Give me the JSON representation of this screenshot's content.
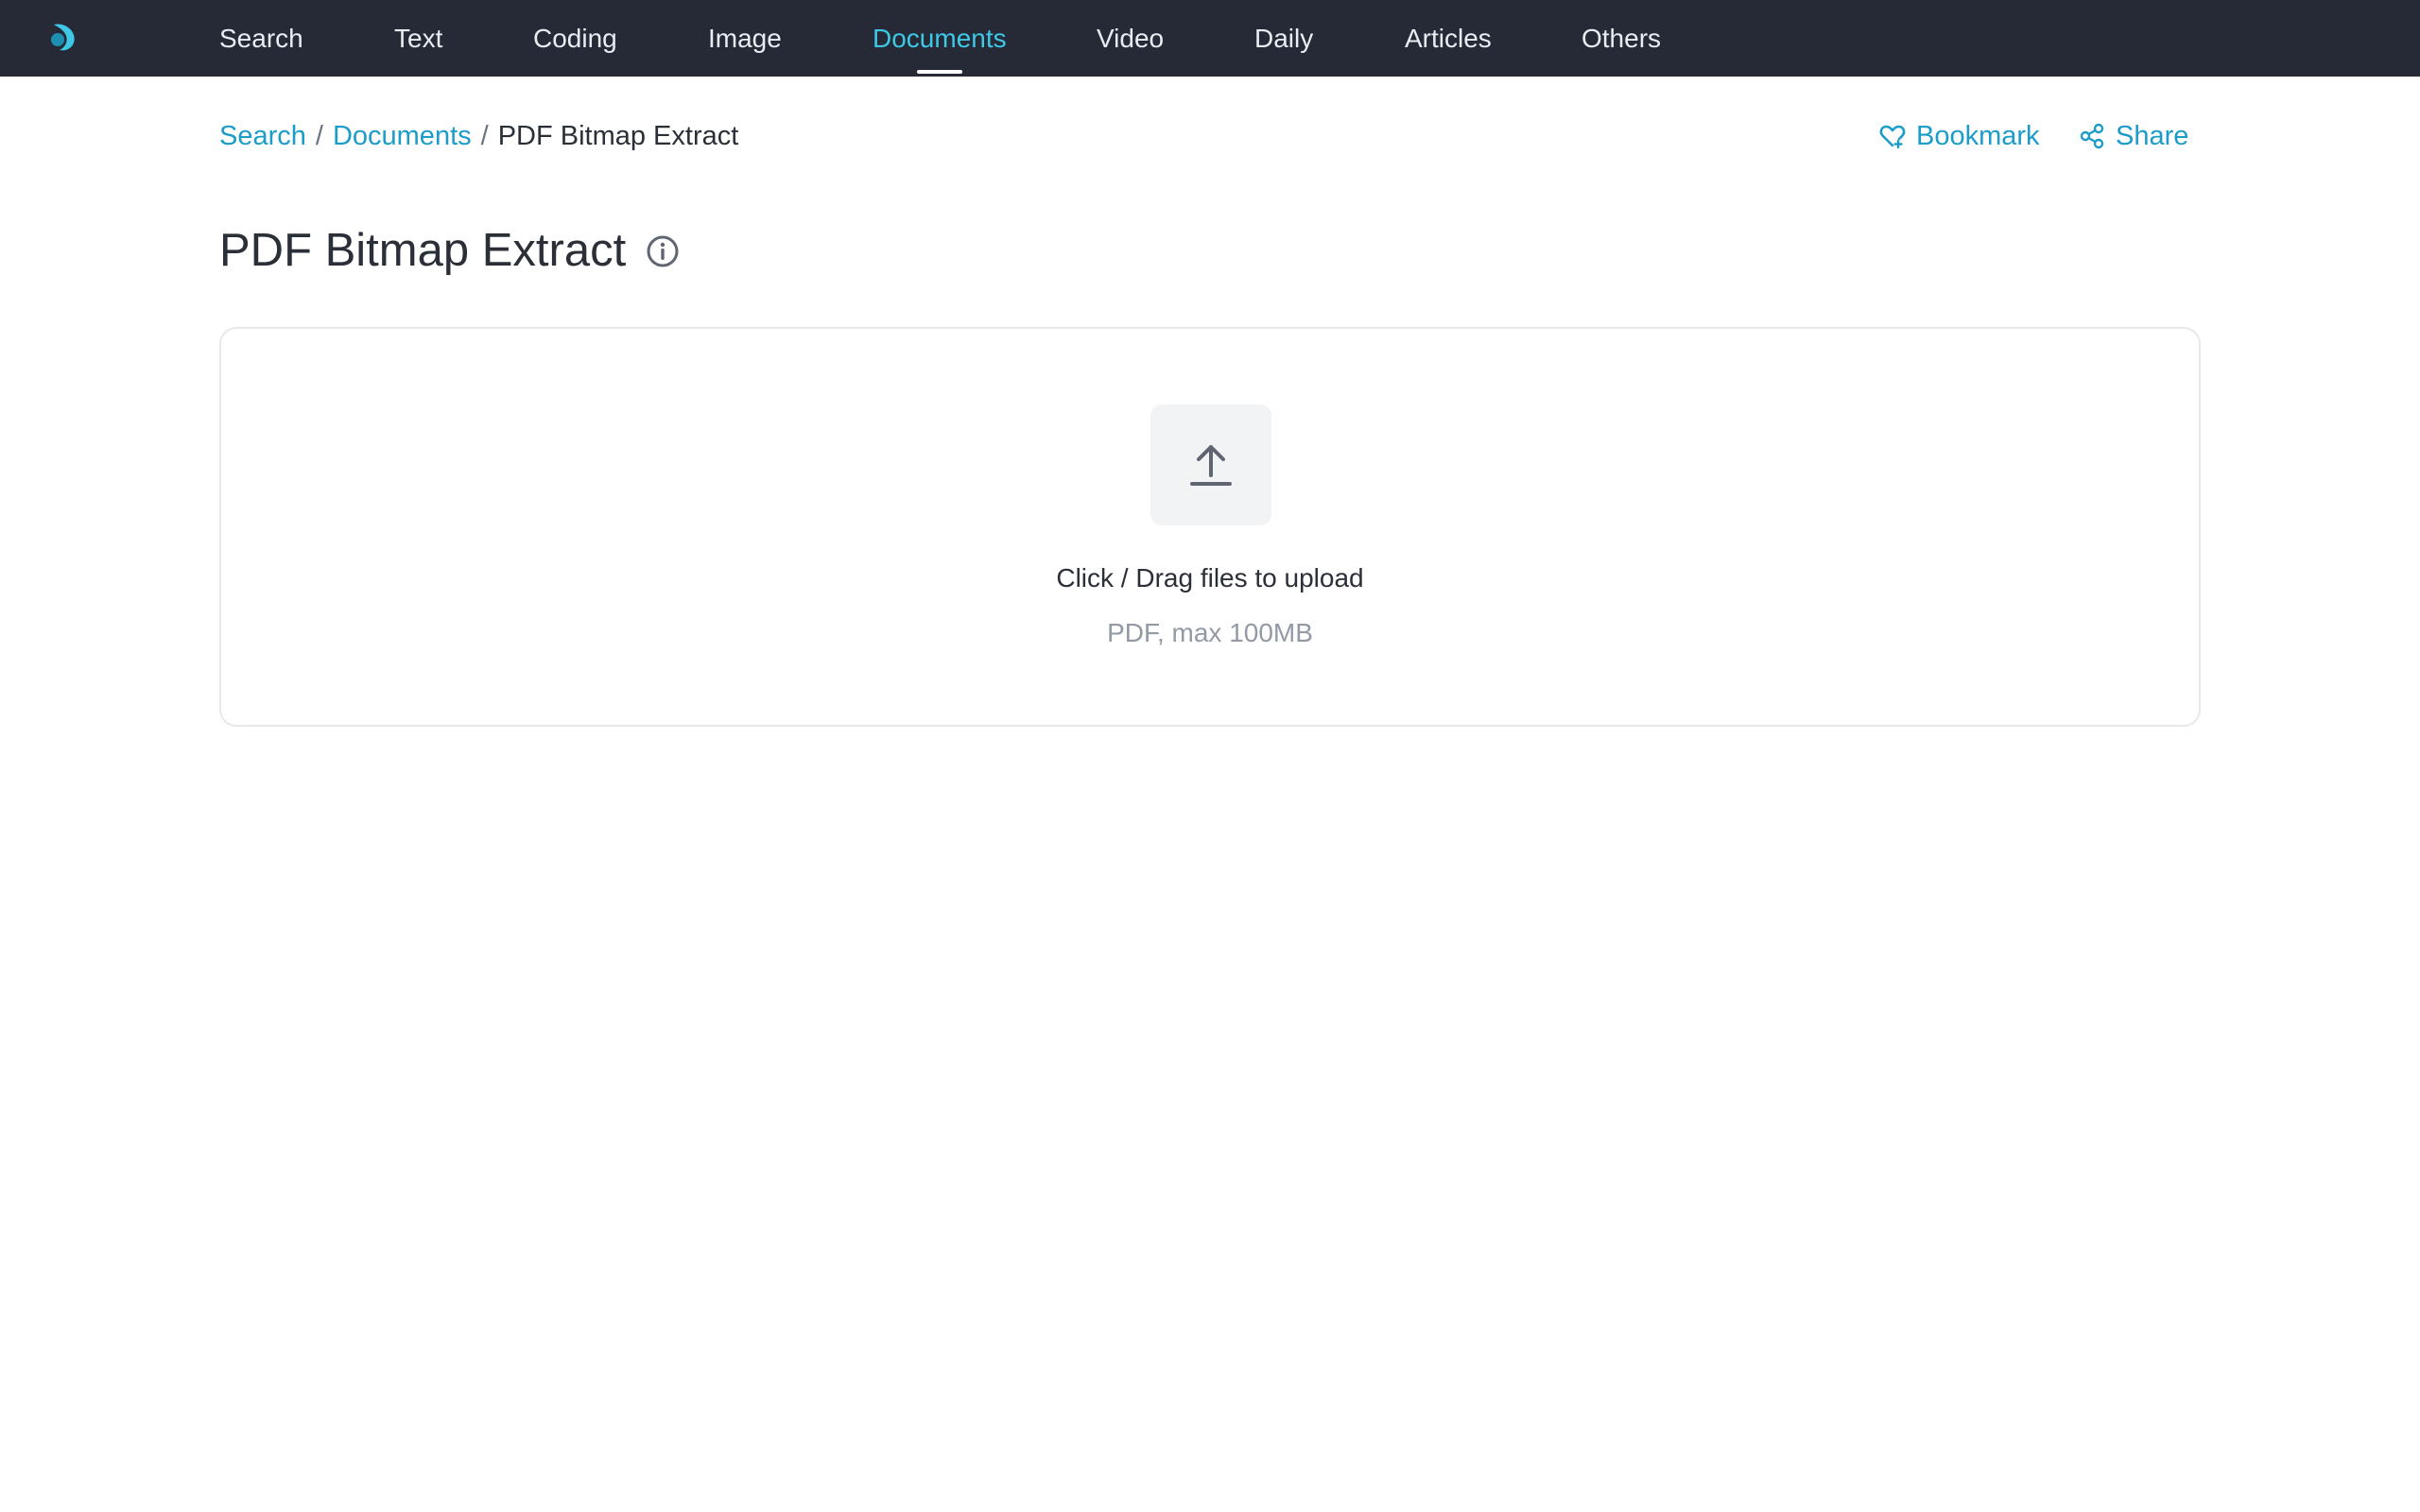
{
  "nav": {
    "items": [
      "Search",
      "Text",
      "Coding",
      "Image",
      "Documents",
      "Video",
      "Daily",
      "Articles",
      "Others"
    ],
    "active": "Documents"
  },
  "breadcrumb": {
    "items": [
      "Search",
      "Documents"
    ],
    "current": "PDF Bitmap Extract"
  },
  "actions": {
    "bookmark": "Bookmark",
    "share": "Share"
  },
  "page": {
    "title": "PDF Bitmap Extract"
  },
  "upload": {
    "title": "Click / Drag files to upload",
    "hint": "PDF, max 100MB"
  },
  "colors": {
    "topbar": "#252a36",
    "accent": "#3fc8e6",
    "link": "#1c9cc9"
  },
  "icons": [
    "logo-icon",
    "heart-bookmark-icon",
    "share-icon",
    "info-icon",
    "upload-arrow-icon"
  ]
}
